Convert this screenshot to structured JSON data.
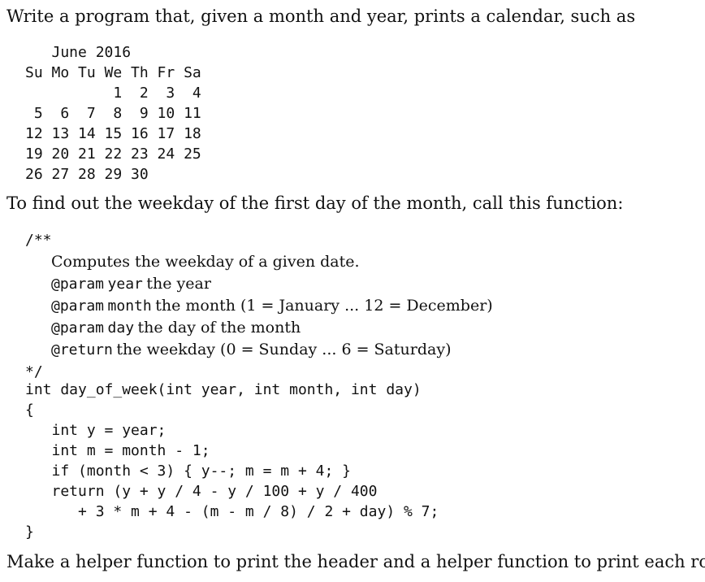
{
  "intro": "Write a program that, given a month and year, prints a calendar, such as",
  "calendar": {
    "title": "   June 2016",
    "header": "Su Mo Tu We Th Fr Sa",
    "weeks": [
      "          1  2  3  4",
      " 5  6  7  8  9 10 11",
      "12 13 14 15 16 17 18",
      "19 20 21 22 23 24 25",
      "26 27 28 29 30"
    ]
  },
  "find_weekday_text": "To find out the weekday of the first day of the month, call this function:",
  "doc_comment": {
    "open": "/**",
    "summary": "Computes the weekday of a given date.",
    "params": [
      {
        "tag": "@param",
        "name": "year",
        "desc": "the year"
      },
      {
        "tag": "@param",
        "name": "month",
        "desc": "the month (1 = January ... 12 = December)"
      },
      {
        "tag": "@param",
        "name": "day",
        "desc": "the day of the month"
      }
    ],
    "return_tag": "@return",
    "return_desc": "the weekday (0 = Sunday ... 6 = Saturday)",
    "close": "*/"
  },
  "code": [
    "int day_of_week(int year, int month, int day)",
    "{",
    "   int y = year;",
    "   int m = month - 1;",
    "   if (month < 3) { y--; m = m + 4; }",
    "   return (y + y / 4 - y / 100 + y / 400",
    "      + 3 * m + 4 - (m - m / 8) / 2 + day) % 7;",
    "}"
  ],
  "closing": "Make a helper function to print the header and a helper function to print each row."
}
